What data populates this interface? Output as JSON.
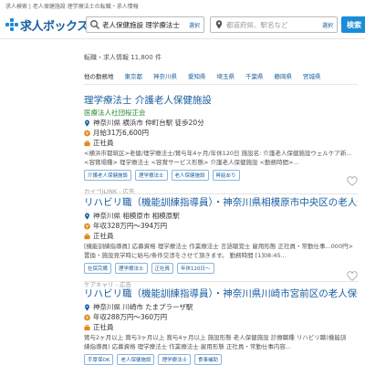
{
  "breadcrumb": "求人検索 | 老人保健施設 理学療法士の転職・求人情報",
  "logo": {
    "text": "求人ボックス"
  },
  "search": {
    "keyword_value": "老人保健施設 理学療法士",
    "keyword_select": "選択",
    "location_placeholder": "都道府県、駅名など",
    "location_select": "選択",
    "button_label": "検索"
  },
  "result_count": "転職・求人情報 11,800 件",
  "regions": {
    "label": "他の勤務地",
    "items": [
      "東京都",
      "神奈川県",
      "愛知県",
      "埼玉県",
      "千葉県",
      "静岡県",
      "宮城県"
    ]
  },
  "jobs": [
    {
      "title": "理学療法士 介護老人保健施設",
      "company": "医療法人社団桜正会",
      "location": "神奈川県 横浜市 仲町台駅 徒歩20分",
      "salary": "月給31万6,600円",
      "employment": "正社員",
      "desc_lines": [
        "<横浜市都筑区>老健/理学療法士/賞与年4ヶ月/年休120日 施設名: 介護老人保健施設ウェルケア新...",
        "<容賞場種> 理学療法士 <容賞サービス形態> 介護老人保健施設 <勤務時間>..."
      ],
      "tags": [
        "介護老人保健施設",
        "理学療法士",
        "老人保健施設",
        "昇給あり"
      ],
      "source": "カイゴJLINK - 広告"
    },
    {
      "title": "リハビリ職（機能訓練指導員）・神奈川県相模原市中央区の老人保...",
      "company": "",
      "location": "神奈川県 相模原市 相模原駅",
      "salary": "年収328万円〜394万円",
      "employment": "正社員",
      "desc_lines": [
        "[機能訓練指導員] 応募資格 理学療法士 作業療法士 言語聴覚士 雇用形態 正社員・常勤仕事...000円>",
        "置換・施設見学時に給与/条件交渉をさせて頂きます。 勤務時間 [1]08:45..."
      ],
      "tags": [
        "社保完備",
        "理学療法士",
        "正社員",
        "年休120日〜"
      ],
      "source": "ケアキャリ - 広告"
    },
    {
      "title": "リハビリ職（機能訓練指導員）・神奈川県川崎市宮前区の老人保健...",
      "company": "",
      "location": "神奈川県 川崎市 たまプラーザ駅",
      "salary": "年収288万円〜360万円",
      "employment": "正社員",
      "desc_lines": [
        "賞与2ヶ月以上 賞与3ヶ月以上 賞与4ヶ月以上 施設形態 老人保健施設 診療職種 リハビリ職(機能訓",
        "練指導員) 応募資格 理学療法士 作業療法士 雇用形態 正社員・常勤仕事内容..."
      ],
      "tags": [
        "手厚保OK",
        "老人保健施設",
        "理学療法士",
        "食事補助"
      ],
      "source": ""
    }
  ]
}
